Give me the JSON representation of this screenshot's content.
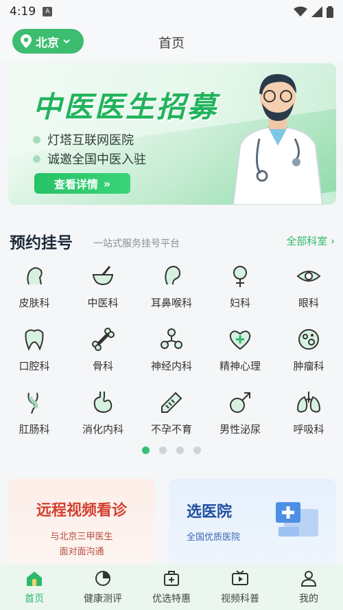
{
  "status_bar": {
    "time": "4:19",
    "a_badge": "A"
  },
  "header": {
    "city": "北京",
    "title": "首页"
  },
  "banner": {
    "title": "中医医生招募",
    "lines": [
      "灯塔互联网医院",
      "诚邀全国中医入驻"
    ],
    "button": "查看详情",
    "button_arrow": "»"
  },
  "booking": {
    "title": "预约挂号",
    "subtitle": "一站式服务挂号平台",
    "all_departments": "全部科室 ›"
  },
  "departments": [
    {
      "label": "皮肤科",
      "icon": "skin-icon"
    },
    {
      "label": "中医科",
      "icon": "mortar-icon"
    },
    {
      "label": "耳鼻喉科",
      "icon": "ear-icon"
    },
    {
      "label": "妇科",
      "icon": "female-icon"
    },
    {
      "label": "眼科",
      "icon": "eye-icon"
    },
    {
      "label": "口腔科",
      "icon": "tooth-icon"
    },
    {
      "label": "骨科",
      "icon": "bone-icon"
    },
    {
      "label": "神经内科",
      "icon": "neuron-icon"
    },
    {
      "label": "精神心理",
      "icon": "heart-icon"
    },
    {
      "label": "肿瘤科",
      "icon": "cell-icon"
    },
    {
      "label": "肛肠科",
      "icon": "intestine-icon"
    },
    {
      "label": "消化内科",
      "icon": "stomach-icon"
    },
    {
      "label": "不孕不育",
      "icon": "thermometer-icon"
    },
    {
      "label": "男性泌尿",
      "icon": "male-icon"
    },
    {
      "label": "呼吸科",
      "icon": "lungs-icon"
    }
  ],
  "pager": {
    "pages": 4,
    "active": 0
  },
  "promo": {
    "video": {
      "title": "远程视频看诊",
      "sub1": "与北京三甲医生",
      "sub2": "面对面沟通"
    },
    "hospital": {
      "title": "选医院",
      "sub": "全国优质医院"
    }
  },
  "tabs": [
    {
      "label": "首页",
      "icon": "home-icon",
      "active": true
    },
    {
      "label": "健康测评",
      "icon": "pie-chart-icon",
      "active": false
    },
    {
      "label": "优选特惠",
      "icon": "medkit-icon",
      "active": false
    },
    {
      "label": "视频科普",
      "icon": "tv-icon",
      "active": false
    },
    {
      "label": "我的",
      "icon": "user-icon",
      "active": false
    }
  ],
  "colors": {
    "accent": "#2fb86a",
    "video_title": "#d2402e",
    "hospital_title": "#1f4fa0"
  }
}
